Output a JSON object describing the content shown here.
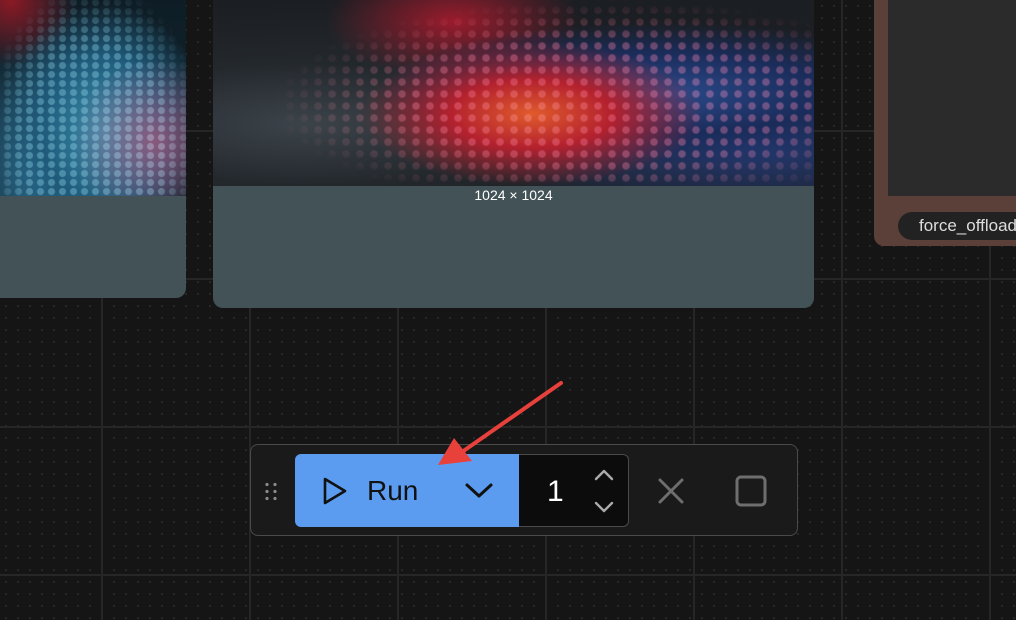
{
  "nodes": {
    "left": {},
    "center": {
      "image_size": "1024 × 1024"
    },
    "right": {
      "widget_label": "force_offload"
    }
  },
  "toolbar": {
    "run_label": "Run",
    "batch_count": "1"
  },
  "colors": {
    "run_button": "#5b9cf0",
    "annotation_arrow": "#e8413c",
    "canvas_bg": "#151515",
    "node_bg": "#435257"
  },
  "icons": {
    "grip": "drag-handle-icon",
    "run": "play-icon",
    "queue_options": "chevron-down-icon",
    "increment": "chevron-up-icon",
    "decrement": "chevron-down-icon",
    "cancel": "close-icon",
    "stop": "square-icon"
  }
}
